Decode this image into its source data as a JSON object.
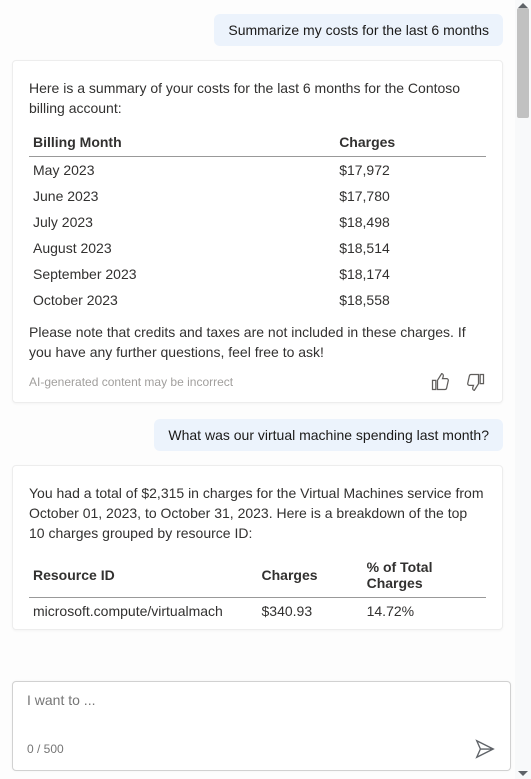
{
  "messages": {
    "user1": "Summarize my costs for the last 6 months",
    "user2": "What was our virtual machine spending last month?"
  },
  "card1": {
    "intro": "Here is a summary of your costs for the last 6 months for the Contoso billing account:",
    "col1": "Billing Month",
    "col2": "Charges",
    "rows": [
      {
        "month": "May 2023",
        "charges": "$17,972"
      },
      {
        "month": "June 2023",
        "charges": "$17,780"
      },
      {
        "month": "July 2023",
        "charges": "$18,498"
      },
      {
        "month": "August 2023",
        "charges": "$18,514"
      },
      {
        "month": "September 2023",
        "charges": "$18,174"
      },
      {
        "month": "October 2023",
        "charges": "$18,558"
      }
    ],
    "outro": "Please note that credits and taxes are not included in these charges. If you have any further questions, feel free to ask!",
    "disclaimer": "AI-generated content may be incorrect"
  },
  "card2": {
    "intro": "You had a total of $2,315 in charges for the Virtual Machines service from October 01, 2023, to October 31, 2023. Here is a breakdown of the top 10 charges grouped by resource ID:",
    "col1": "Resource ID",
    "col2": "Charges",
    "col3": "% of Total Charges",
    "row0": {
      "res": "microsoft.compute/virtualmach",
      "charges": "$340.93",
      "pct": "14.72%"
    }
  },
  "input": {
    "placeholder": "I want to ...",
    "counter": "0 / 500"
  }
}
